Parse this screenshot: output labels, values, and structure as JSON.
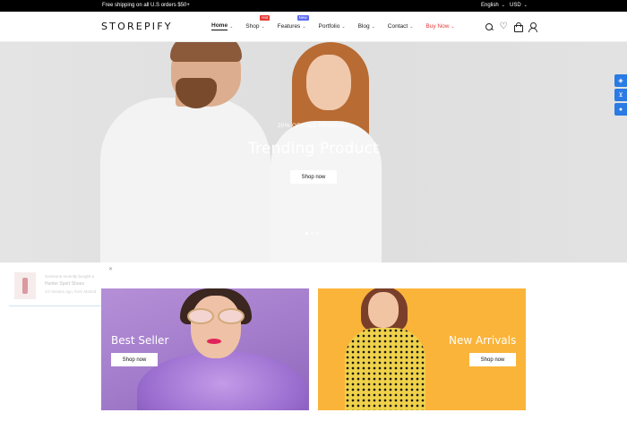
{
  "topbar": {
    "shipping_text": "Free shipping on all U.S orders $50+",
    "language": "English",
    "currency": "USD"
  },
  "header": {
    "logo": "STOREPIFY",
    "nav": [
      {
        "label": "Home",
        "badge": ""
      },
      {
        "label": "Shop",
        "badge": "Hot"
      },
      {
        "label": "Features",
        "badge": "New"
      },
      {
        "label": "Portfolio",
        "badge": ""
      },
      {
        "label": "Blog",
        "badge": ""
      },
      {
        "label": "Contact",
        "badge": ""
      },
      {
        "label": "Buy Now",
        "badge": ""
      }
    ],
    "icons": [
      "search-icon",
      "heart-icon",
      "bag-icon",
      "user-icon"
    ]
  },
  "hero": {
    "subtitle": "20% OFF ALL PRODUCT",
    "title": "Trending Product",
    "button": "Shop now",
    "slides": 3,
    "active_slide": 1
  },
  "popup": {
    "line1": "Someone recently bought a",
    "line2": "Hunter Sport Shoes",
    "line3": "10 minutes ago, from Madrid"
  },
  "banners": {
    "left": {
      "title": "Best Seller",
      "button": "Shop now"
    },
    "right": {
      "title": "New Arrivals",
      "button": "Shop now"
    }
  },
  "colors": {
    "accent_red": "#e53935",
    "badge_new": "#5b6bf0",
    "side_tool_blue": "#2a7be4",
    "banner_purple": "#a27ccb",
    "banner_yellow": "#fbb43a"
  }
}
